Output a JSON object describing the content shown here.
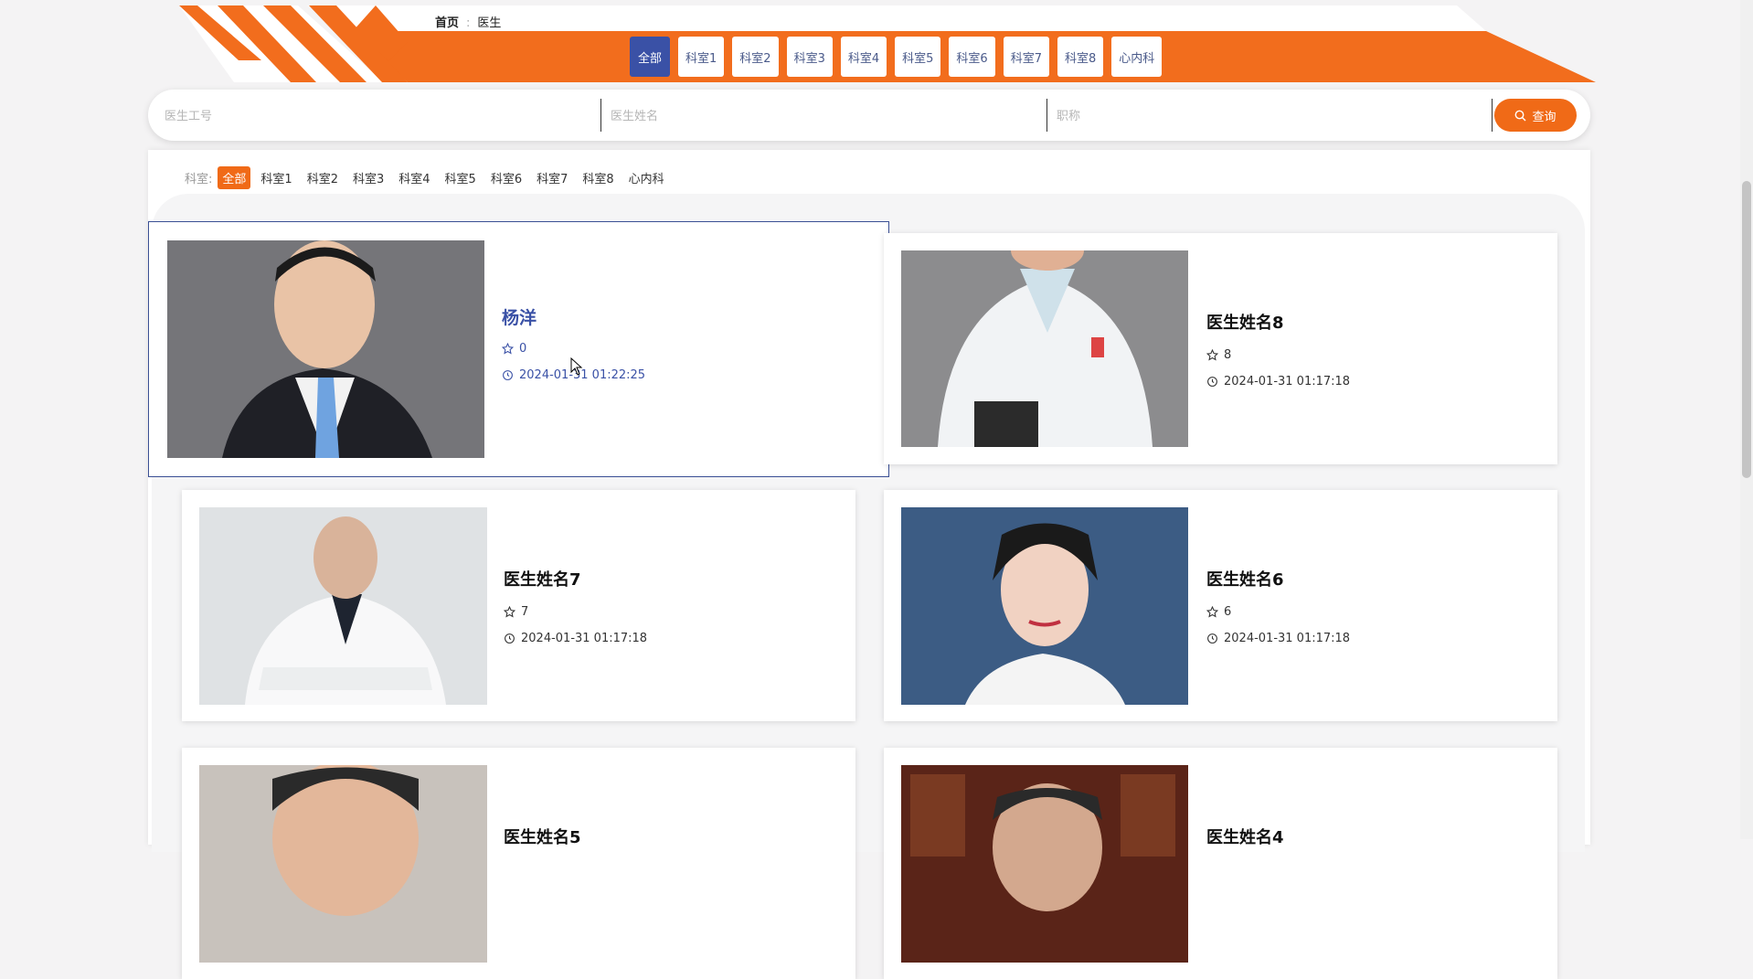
{
  "breadcrumb": {
    "home": "首页",
    "separator": ":",
    "current": "医生"
  },
  "category_tabs": [
    "全部",
    "科室1",
    "科室2",
    "科室3",
    "科室4",
    "科室5",
    "科室6",
    "科室7",
    "科室8",
    "心内科"
  ],
  "search": {
    "doctor_id_placeholder": "医生工号",
    "doctor_name_placeholder": "医生姓名",
    "title_placeholder": "职称",
    "button_label": "查询"
  },
  "dept_filter": {
    "label": "科室:",
    "items": [
      "全部",
      "科室1",
      "科室2",
      "科室3",
      "科室4",
      "科室5",
      "科室6",
      "科室7",
      "科室8",
      "心内科"
    ]
  },
  "doctors": [
    {
      "name": "杨洋",
      "likes": "0",
      "time": "2024-01-31 01:22:25"
    },
    {
      "name": "医生姓名8",
      "likes": "8",
      "time": "2024-01-31 01:17:18"
    },
    {
      "name": "医生姓名7",
      "likes": "7",
      "time": "2024-01-31 01:17:18"
    },
    {
      "name": "医生姓名6",
      "likes": "6",
      "time": "2024-01-31 01:17:18"
    },
    {
      "name": "医生姓名5",
      "likes": "",
      "time": ""
    },
    {
      "name": "医生姓名4",
      "likes": "",
      "time": ""
    }
  ],
  "colors": {
    "accent": "#f06a17",
    "primary": "#3a51a6"
  }
}
